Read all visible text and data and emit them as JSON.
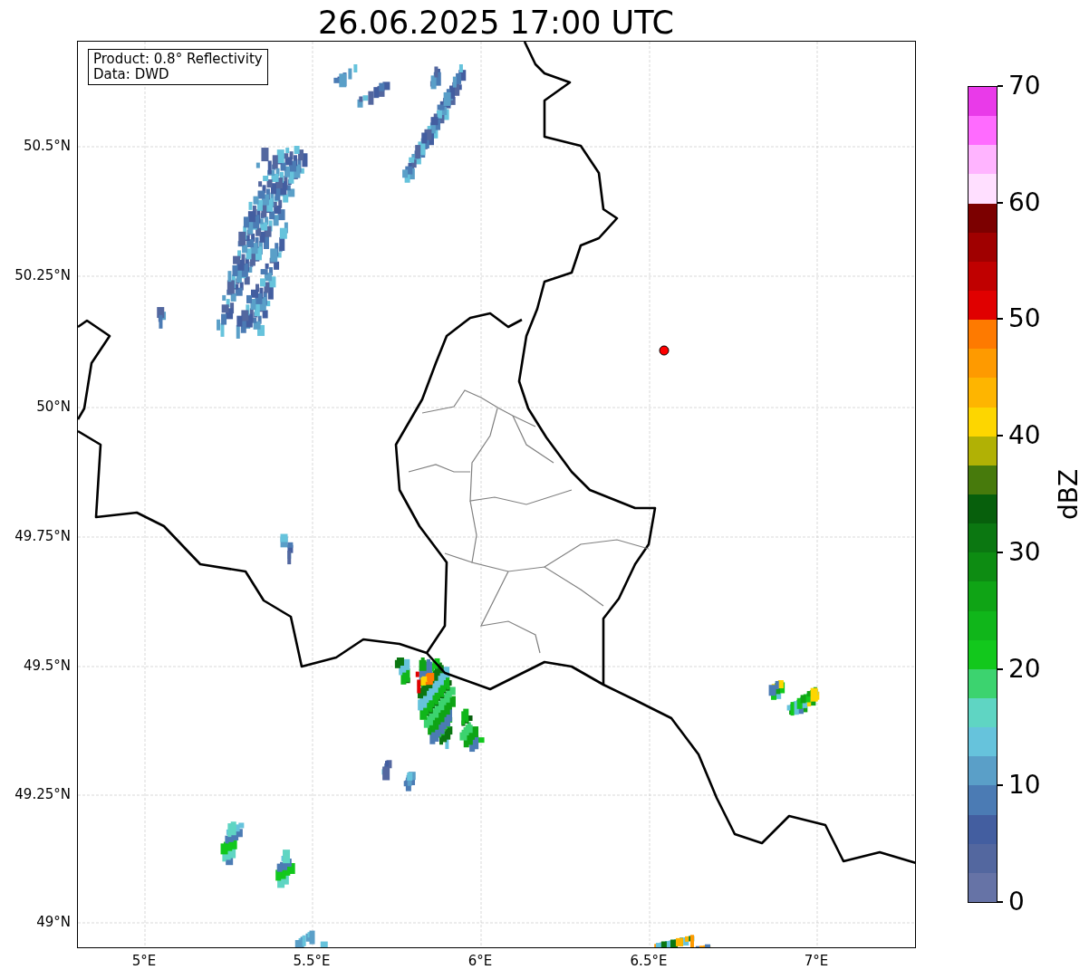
{
  "title": "26.06.2025 17:00 UTC",
  "info_box": [
    "Product: 0.8° Reflectivity",
    "Data: DWD"
  ],
  "y_ticks": [
    "50.5°N",
    "50.25°N",
    "50°N",
    "49.75°N",
    "49.5°N",
    "49.25°N",
    "49°N"
  ],
  "x_ticks": [
    "5°E",
    "5.5°E",
    "6°E",
    "6.5°E",
    "7°E"
  ],
  "colorbar": {
    "label": "dBZ",
    "ticks": [
      "70",
      "60",
      "50",
      "40",
      "30",
      "20",
      "10",
      "0"
    ],
    "segments": [
      {
        "color": "#6673a6"
      },
      {
        "color": "#53679f"
      },
      {
        "color": "#435ea0"
      },
      {
        "color": "#4b7bb4"
      },
      {
        "color": "#5a9fc8"
      },
      {
        "color": "#66c3dc"
      },
      {
        "color": "#5fd5c3"
      },
      {
        "color": "#3cd36f"
      },
      {
        "color": "#12c81c"
      },
      {
        "color": "#10b61a"
      },
      {
        "color": "#0fa415"
      },
      {
        "color": "#0d8c12"
      },
      {
        "color": "#0b7711"
      },
      {
        "color": "#075f0c"
      },
      {
        "color": "#477a0c"
      },
      {
        "color": "#b1b105"
      },
      {
        "color": "#fdd600"
      },
      {
        "color": "#feb500"
      },
      {
        "color": "#fe9a00"
      },
      {
        "color": "#fe7a00"
      },
      {
        "color": "#e00000"
      },
      {
        "color": "#c00000"
      },
      {
        "color": "#a00000"
      },
      {
        "color": "#7c0000"
      },
      {
        "color": "#ffdfff"
      },
      {
        "color": "#ffb4ff"
      },
      {
        "color": "#ff6bff"
      },
      {
        "color": "#e93ae9"
      }
    ]
  }
}
